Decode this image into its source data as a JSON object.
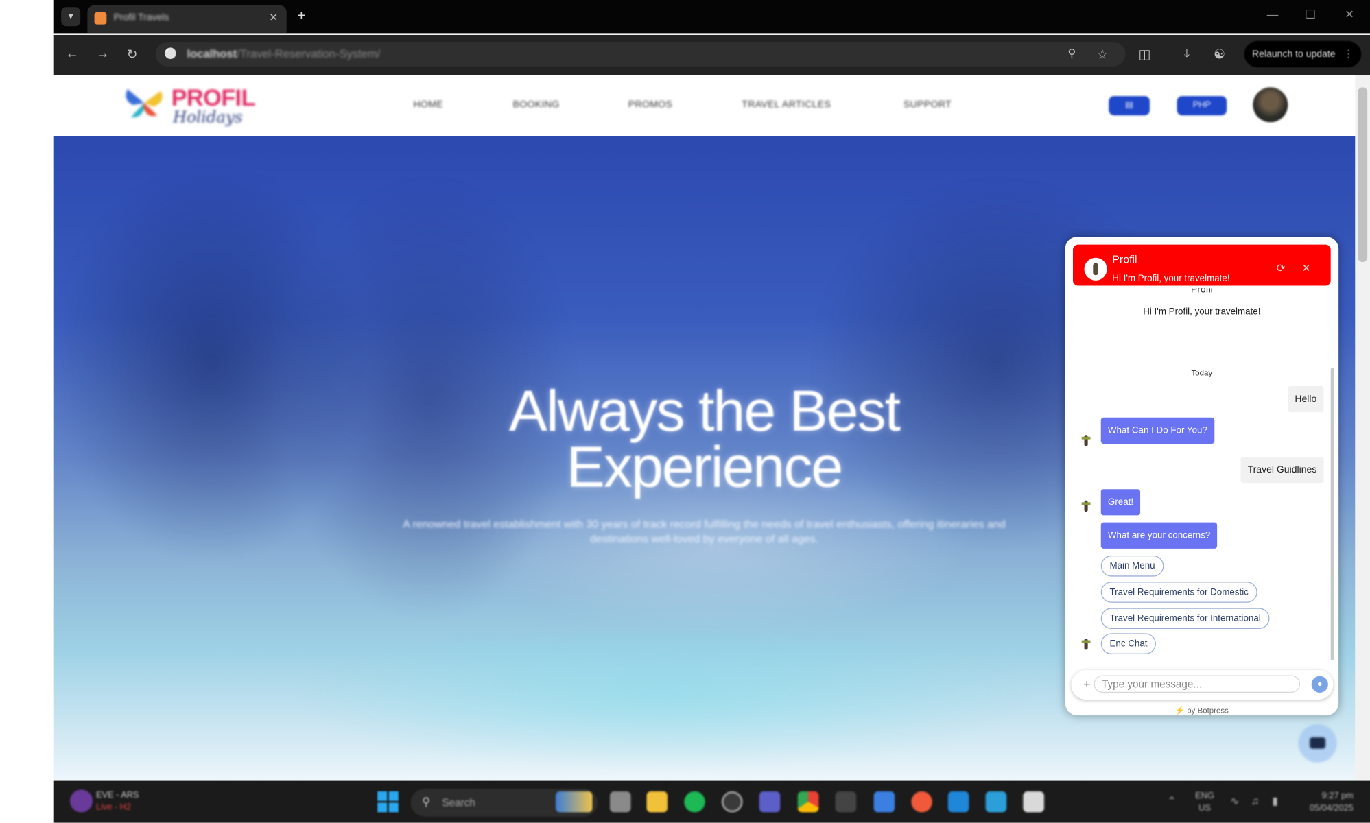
{
  "browser": {
    "tab_title": "Profil Travels",
    "url_host": "localhost",
    "url_path": "/Travel-Reservation-System/",
    "relaunch_label": "Relaunch to update"
  },
  "site": {
    "logo_text": "PROFIL",
    "logo_sub": "Holidays",
    "nav": [
      "HOME",
      "BOOKING",
      "PROMOS",
      "TRAVEL ARTICLES",
      "SUPPORT"
    ],
    "pill_lang": "",
    "pill_currency": "PHP"
  },
  "hero": {
    "title_line1": "Always the Best",
    "title_line2": "Experience",
    "subtitle": "A renowned travel establishment with 30 years of track record fulfilling the needs of travel enthusiasts, offering itineraries and destinations well-loved by everyone of all ages."
  },
  "chat": {
    "bot_name": "Profil",
    "tagline": "Hi I'm Profil, your travelmate!",
    "intro_name": "Profil",
    "intro_tagline": "Hi I'm Profil, your travelmate!",
    "day_label": "Today",
    "messages": {
      "user1": "Hello",
      "bot1": "What Can I Do For You?",
      "user2": "Travel Guidlines",
      "bot2": "Great!",
      "bot3": "What are your concerns?"
    },
    "quick_replies": [
      "Main Menu",
      "Travel Requirements for Domestic",
      "Travel Requirements for International",
      "Enc Chat"
    ],
    "input_placeholder": "Type your message...",
    "powered_by": "by Botpress"
  },
  "taskbar": {
    "game_line1": "EVE - ARS",
    "game_line2": "Live - H2",
    "search_label": "Search",
    "lang_line1": "ENG",
    "lang_line2": "US",
    "time": "9:27 pm",
    "date": "05/04/2025"
  },
  "colors": {
    "chat_header": "#ff0000",
    "bot_bubble": "#6a73f1",
    "brand_pink": "#e2336b",
    "header_pill": "#1f47c9"
  },
  "icons": [
    "tab-menu-icon",
    "favicon-icon",
    "close-icon",
    "plus-icon",
    "back-icon",
    "forward-icon",
    "reload-icon",
    "site-info-icon",
    "zoom-icon",
    "star-icon",
    "extensions-icon",
    "download-icon",
    "profile-icon",
    "more-icon",
    "refresh-icon",
    "mic-icon",
    "chat-fab-icon",
    "windows-start-icon",
    "search-icon"
  ]
}
